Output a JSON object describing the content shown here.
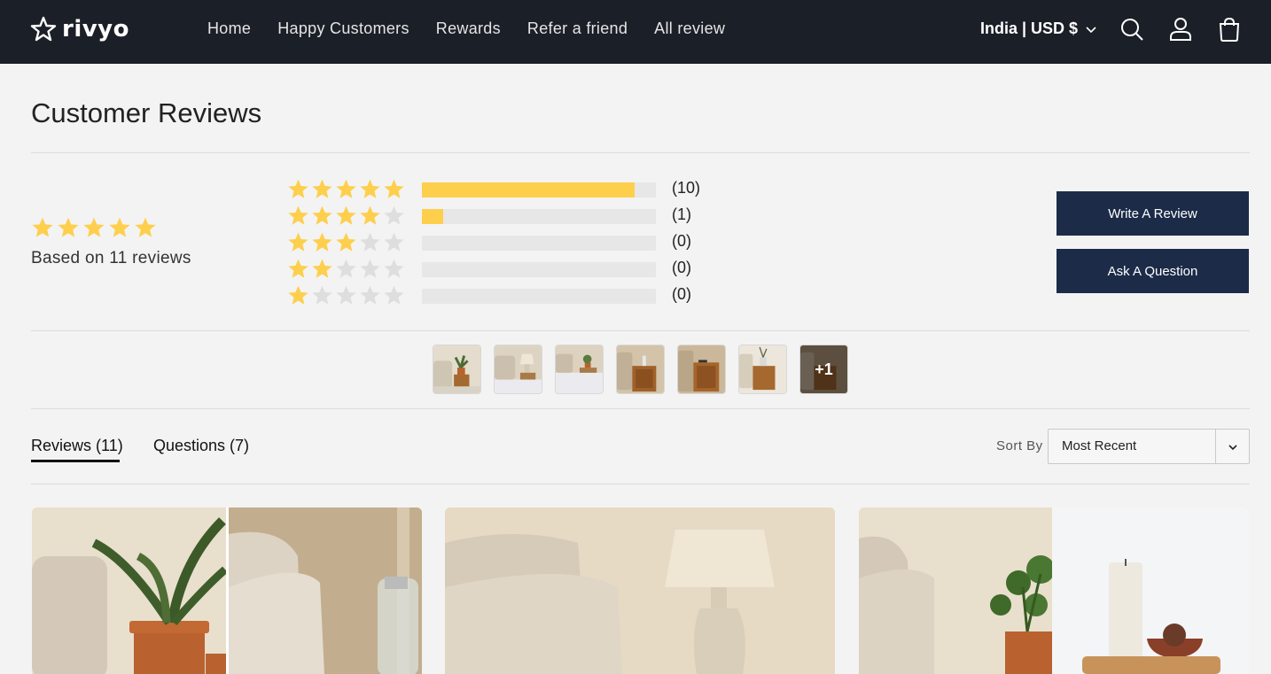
{
  "brand": {
    "name": "rivyo"
  },
  "nav": [
    "Home",
    "Happy Customers",
    "Rewards",
    "Refer a friend",
    "All review"
  ],
  "locale": "India | USD $",
  "title": "Customer Reviews",
  "summary": {
    "average_rating": 5,
    "based_on": "Based on 11 reviews",
    "distribution": [
      {
        "stars": 5,
        "count_label": "(10)",
        "fraction": 0.91
      },
      {
        "stars": 4,
        "count_label": "(1)",
        "fraction": 0.09
      },
      {
        "stars": 3,
        "count_label": "(0)",
        "fraction": 0
      },
      {
        "stars": 2,
        "count_label": "(0)",
        "fraction": 0
      },
      {
        "stars": 1,
        "count_label": "(0)",
        "fraction": 0
      }
    ]
  },
  "buttons": {
    "write": "Write A Review",
    "ask": "Ask A Question"
  },
  "thumbnails": {
    "more_label": "+1"
  },
  "tabs": {
    "reviews": "Reviews (11)",
    "questions": "Questions (7)"
  },
  "sort": {
    "label": "Sort By",
    "selected": "Most Recent"
  },
  "colors": {
    "header_bg": "#1b1f27",
    "star": "#fdcf4c",
    "button_bg": "#1c2b48"
  }
}
